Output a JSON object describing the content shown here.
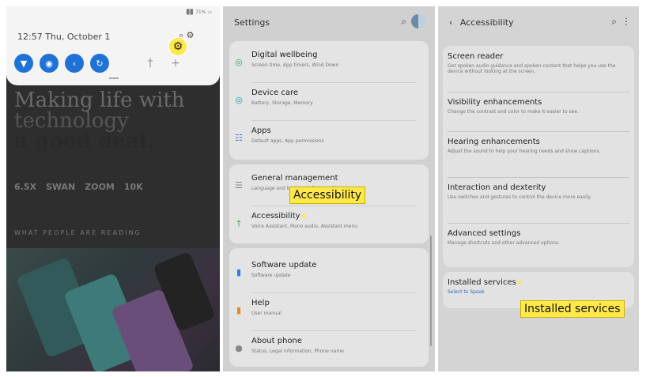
{
  "panel1": {
    "status_right": "▊▊ 71% ▭",
    "time_date": "12:57 Thu, October 1",
    "status_icons": "⌕  ⚙",
    "gear_icon": "⚙",
    "quick_settings": [
      {
        "icon": "wifi-icon",
        "glyph": "▼"
      },
      {
        "icon": "sound-icon",
        "glyph": "◉"
      },
      {
        "icon": "bluetooth-icon",
        "glyph": "‹"
      },
      {
        "icon": "rotate-icon",
        "glyph": "↻"
      }
    ],
    "flashlight_glyph": "†",
    "add_glyph": "+",
    "headline_line1": "Making life with",
    "headline_line2": "technology",
    "headline_line3": "a good deal.",
    "stats": [
      "6.5X",
      "SWAN",
      "ZOOM",
      "10K"
    ],
    "reading": "WHAT PEOPLE ARE READING"
  },
  "panel2": {
    "title": "Settings",
    "search_glyph": "⌕",
    "items": [
      {
        "title": "Digital wellbeing",
        "sub": "Screen time, App timers, Wind Down",
        "glyph": "◎",
        "color": "#3aa55a"
      },
      {
        "title": "Device care",
        "sub": "Battery, Storage, Memory",
        "glyph": "◎",
        "color": "#1aa5a5"
      },
      {
        "title": "Apps",
        "sub": "Default apps, App permissions",
        "glyph": "☷",
        "color": "#3a78c9"
      },
      {
        "title": "General management",
        "sub": "Language and keyboard, Date and time",
        "glyph": "☰",
        "color": "#888888"
      },
      {
        "title": "Accessibility",
        "sub": "Voice Assistant, Mono audio, Assistant menu",
        "glyph": "†",
        "color": "#4aa05a"
      },
      {
        "title": "Software update",
        "sub": "Software update",
        "glyph": "▮",
        "color": "#2a7be4"
      },
      {
        "title": "Help",
        "sub": "User manual",
        "glyph": "▮",
        "color": "#e08a20"
      },
      {
        "title": "About phone",
        "sub": "Status, Legal information, Phone name",
        "glyph": "●",
        "color": "#888888"
      }
    ],
    "callout": "Accessibility"
  },
  "panel3": {
    "back_glyph": "‹",
    "title": "Accessibility",
    "search_glyph": "⌕",
    "more_glyph": "⋮",
    "items": [
      {
        "title": "Screen reader",
        "sub": "Get spoken audio guidance and spoken content that helps you use the device without looking at the screen."
      },
      {
        "title": "Visibility enhancements",
        "sub": "Change the contrast and color to make it easier to see."
      },
      {
        "title": "Hearing enhancements",
        "sub": "Adjust the sound to help your hearing needs and show captions."
      },
      {
        "title": "Interaction and dexterity",
        "sub": "Use switches and gestures to control the device more easily."
      },
      {
        "title": "Advanced settings",
        "sub": "Manage shortcuts and other advanced options."
      }
    ],
    "installed": {
      "title": "Installed services",
      "sub": "Select to Speak"
    },
    "callout": "Installed services"
  }
}
